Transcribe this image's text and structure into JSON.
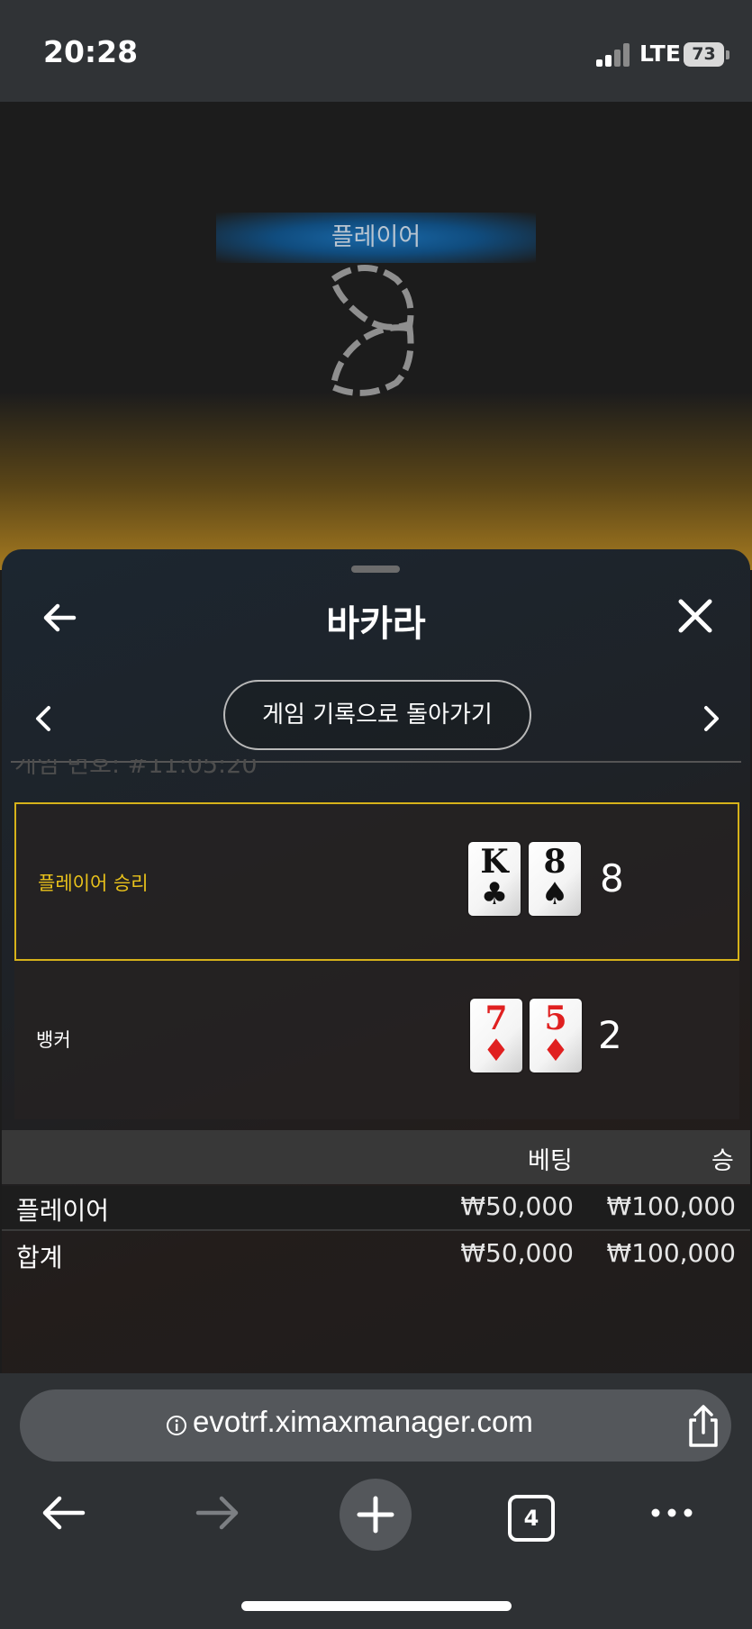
{
  "status_bar": {
    "time": "20:28",
    "network": "LTE",
    "battery": "73"
  },
  "game": {
    "player_banner": "플레이어"
  },
  "sheet": {
    "title": "바카라",
    "history_button": "게임 기록으로 돌아가기",
    "game_number": "게임 번호: #11:05:20"
  },
  "hands": {
    "player": {
      "label": "플레이어 승리",
      "cards": [
        {
          "rank": "K",
          "suit": "♣"
        },
        {
          "rank": "8",
          "suit": "♠"
        }
      ],
      "total": "8"
    },
    "banker": {
      "label": "뱅커",
      "cards": [
        {
          "rank": "7",
          "suit": "♦"
        },
        {
          "rank": "5",
          "suit": "♦"
        }
      ],
      "total": "2"
    }
  },
  "bets": {
    "headers": {
      "bet": "베팅",
      "win": "승"
    },
    "rows": [
      {
        "name": "플레이어",
        "bet": "₩50,000",
        "win": "₩100,000"
      },
      {
        "name": "합계",
        "bet": "₩50,000",
        "win": "₩100,000"
      }
    ]
  },
  "browser": {
    "url": "evotrf.ximaxmanager.com",
    "tab_count": "4"
  },
  "colors": {
    "winner_accent": "#e9c21b",
    "banner_blue": "#1968a8",
    "card_red": "#e02020"
  },
  "icons": [
    "back-arrow-icon",
    "close-icon",
    "chevron-left-icon",
    "chevron-right-icon",
    "info-icon",
    "share-icon",
    "plus-icon",
    "more-icon"
  ]
}
